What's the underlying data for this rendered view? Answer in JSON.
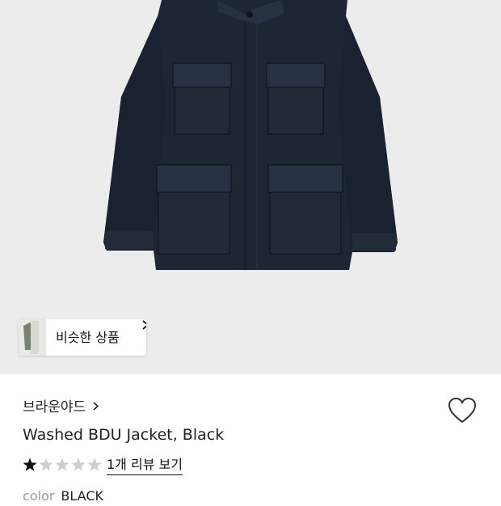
{
  "product_image": {
    "subject": "navy washed BDU jacket with four flap pockets",
    "background_color": "#ececec",
    "jacket_color": "#1f2633"
  },
  "similar_button": {
    "label": "비슷한 상품",
    "icon": "chevron-right-icon",
    "thumbnail_color": "#7a8470"
  },
  "brand": {
    "name": "브라운야드",
    "icon": "chevron-right-icon"
  },
  "wishlist": {
    "icon": "heart-outline-icon",
    "color": "#333333"
  },
  "product": {
    "title": "Washed BDU Jacket, Black"
  },
  "rating": {
    "stars_filled": 1,
    "stars_total": 5,
    "filled_color": "#111111",
    "empty_color": "#cfcfcf",
    "review_link": "1개 리뷰 보기"
  },
  "option": {
    "key": "color",
    "value": "BLACK"
  }
}
